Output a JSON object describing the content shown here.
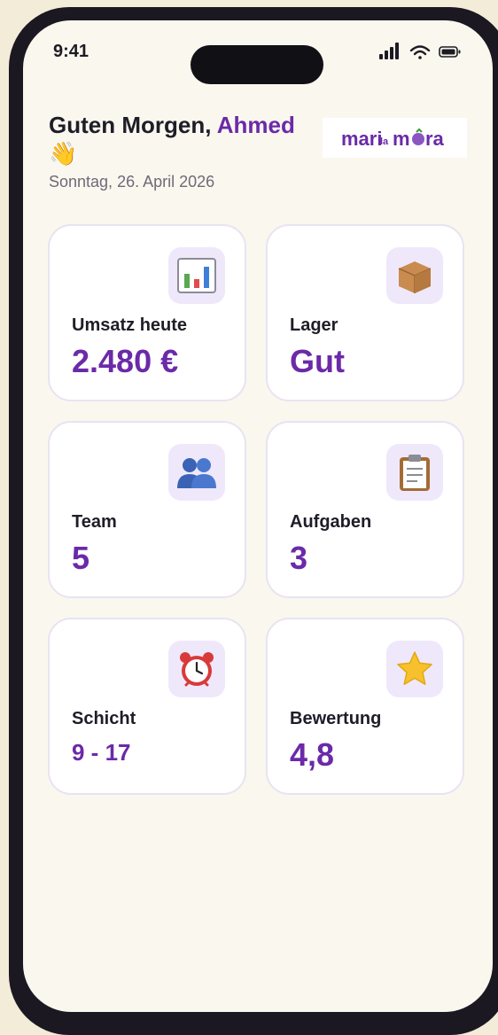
{
  "status_bar": {
    "time": "9:41"
  },
  "header": {
    "greeting_prefix": "Guten Morgen,",
    "name": "Ahmed",
    "wave": "👋",
    "date": "Sonntag, 26. April 2026",
    "logo": {
      "part1": "mari",
      "part2": "la",
      "part3": "mora",
      "color": "#6b2aa8"
    }
  },
  "cards": [
    {
      "label": "Umsatz heute",
      "value": "2.480 €",
      "icon": "bar-chart-icon",
      "glyph": "📊"
    },
    {
      "label": "Lager",
      "value": "Gut",
      "icon": "package-icon",
      "glyph": "📦"
    },
    {
      "label": "Team",
      "value": "5",
      "icon": "people-icon",
      "glyph": "👥"
    },
    {
      "label": "Aufgaben",
      "value": "3",
      "icon": "clipboard-icon",
      "glyph": "📋"
    },
    {
      "label": "Schicht",
      "value": "9 - 17",
      "icon": "alarm-clock-icon",
      "glyph": "⏰"
    },
    {
      "label": "Bewertung",
      "value": "4,8",
      "icon": "star-icon",
      "glyph": "⭐"
    }
  ],
  "colors": {
    "accent": "#6b2aa8",
    "background": "#faf7ef",
    "icon_bg": "#efe8fb"
  }
}
